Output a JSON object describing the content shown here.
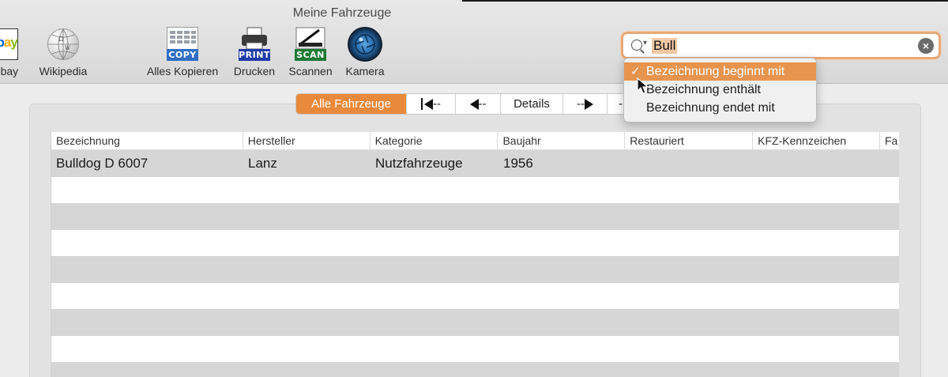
{
  "window": {
    "title": "Meine Fahrzeuge"
  },
  "toolbar": {
    "items": [
      {
        "label": "ebay",
        "icon": "ebay-icon"
      },
      {
        "label": "Wikipedia",
        "icon": "wikipedia-globe-icon"
      },
      {
        "label": "Alles Kopieren",
        "icon": "copy-icon",
        "badge": "COPY"
      },
      {
        "label": "Drucken",
        "icon": "printer-icon",
        "badge": "PRINT"
      },
      {
        "label": "Scannen",
        "icon": "scanner-icon",
        "badge": "SCAN"
      },
      {
        "label": "Kamera",
        "icon": "camera-icon"
      }
    ]
  },
  "search": {
    "value": "Bull"
  },
  "search_menu": {
    "items": [
      {
        "label": "Bezeichnung beginnt mit",
        "checked": true
      },
      {
        "label": "Bezeichnung enthält",
        "checked": false
      },
      {
        "label": "Bezeichnung endet mit",
        "checked": false
      }
    ],
    "check_mark": "✓"
  },
  "navigation": {
    "segments": [
      {
        "label": "Alle Fahrzeuge"
      },
      {
        "label": "--",
        "icon": "first-record-icon"
      },
      {
        "label": "--",
        "icon": "previous-record-icon"
      },
      {
        "label": "Details"
      },
      {
        "label": "--",
        "icon": "next-record-icon"
      },
      {
        "label": "-"
      }
    ]
  },
  "table": {
    "columns": [
      "Bezeichnung",
      "Hersteller",
      "Kategorie",
      "Baujahr",
      "Restauriert",
      "KFZ-Kennzeichen",
      "Fa"
    ],
    "rows": [
      [
        "Bulldog D 6007",
        "Lanz",
        "Nutzfahrzeuge",
        "1956",
        "",
        "",
        ""
      ]
    ]
  },
  "colors": {
    "accent": "#e9893c",
    "menu_highlight": "#e7944f",
    "search_focus_ring": "#e7a97a",
    "row_alternate": "#d6d6d6"
  }
}
